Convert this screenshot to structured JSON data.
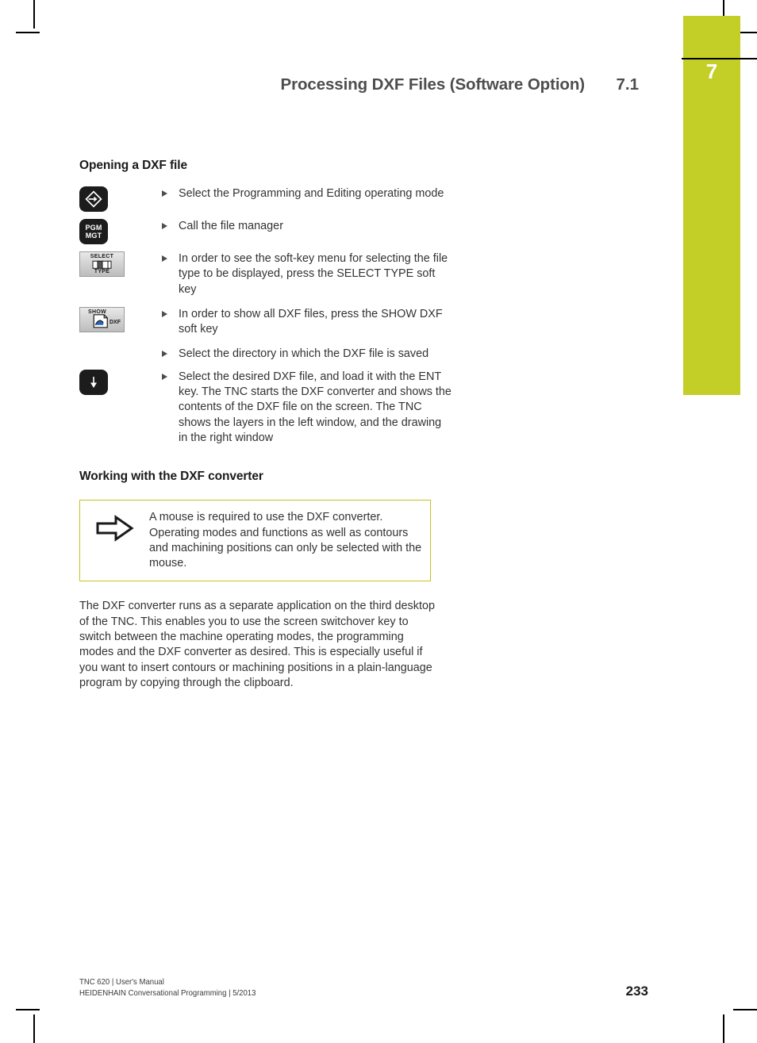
{
  "chapter_tab": {
    "number": "7",
    "color": "#c3ce26"
  },
  "header": {
    "title": "Processing DXF Files (Software Option)",
    "section": "7.1"
  },
  "sections": {
    "opening": {
      "heading": "Opening a DXF file",
      "steps": [
        {
          "key": {
            "type": "hardkey",
            "icon": "programming-editing-mode-icon",
            "label": ""
          },
          "text": "Select the Programming and Editing operating mode"
        },
        {
          "key": {
            "type": "hardkey",
            "icon": "pgm-mgt-key-icon",
            "label_line1": "PGM",
            "label_line2": "MGT"
          },
          "text": "Call the file manager"
        },
        {
          "key": {
            "type": "softkey",
            "icon": "select-type-softkey-icon",
            "top": "SELECT",
            "bottom": "TYPE"
          },
          "text": "In order to see the soft-key menu for selecting the file type to be displayed, press the SELECT TYPE soft key"
        },
        {
          "key": {
            "type": "softkey",
            "icon": "show-dxf-softkey-icon",
            "top": "SHOW",
            "side": ". DXF"
          },
          "text": "In order to show all DXF files, press the SHOW DXF soft key"
        },
        {
          "key": {
            "type": "none"
          },
          "text": "Select the directory in which the DXF file is saved"
        },
        {
          "key": {
            "type": "hardkey",
            "icon": "ent-key-icon",
            "label": ""
          },
          "text": "Select the desired DXF file, and load it with the ENT key. The TNC starts the DXF converter and shows the contents of the DXF file on the screen. The TNC shows the layers in the left window, and the drawing in the right window"
        }
      ]
    },
    "working": {
      "heading": "Working with the DXF converter",
      "note": {
        "icon": "arrow-right-outline-icon",
        "border_color": "#c8c41e",
        "text": "A mouse is required to use the DXF converter. Operating modes and functions as well as contours and machining positions can only be selected with the mouse."
      },
      "paragraph": "The DXF converter runs as a separate application on the third desktop of the TNC. This enables you to use the screen switchover key to switch between the machine operating modes, the programming modes and the DXF converter as desired. This is especially useful if you want to insert contours or machining positions in a plain-language program by copying through the clipboard."
    }
  },
  "footer": {
    "line1": "TNC 620 | User's Manual",
    "line2": "HEIDENHAIN Conversational Programming | 5/2013",
    "page_number": "233"
  }
}
